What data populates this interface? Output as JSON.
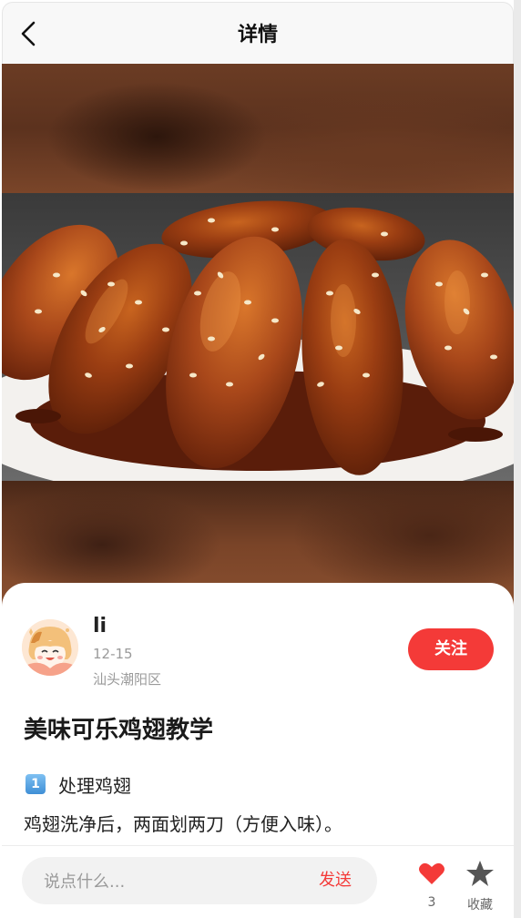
{
  "header": {
    "title": "详情",
    "back_icon": "chevron-left-icon"
  },
  "hero": {
    "image_subject": "cola-chicken-wings-photo"
  },
  "author": {
    "name": "li",
    "date": "12-15",
    "location": "汕头潮阳区",
    "follow_label": "关注",
    "avatar_icon": "cartoon-girl-avatar"
  },
  "post": {
    "title": "美味可乐鸡翅教学",
    "step": {
      "number": "1",
      "label": "处理鸡翅",
      "description": "鸡翅洗净后，两面划两刀（方便入味）。"
    }
  },
  "bottom_bar": {
    "comment_placeholder": "说点什么...",
    "send_label": "发送",
    "like_count": "3",
    "favorite_label": "收藏",
    "like_icon": "heart-icon",
    "favorite_icon": "star-icon"
  },
  "colors": {
    "accent": "#f43a38",
    "header_bg": "#f8f8f8"
  }
}
